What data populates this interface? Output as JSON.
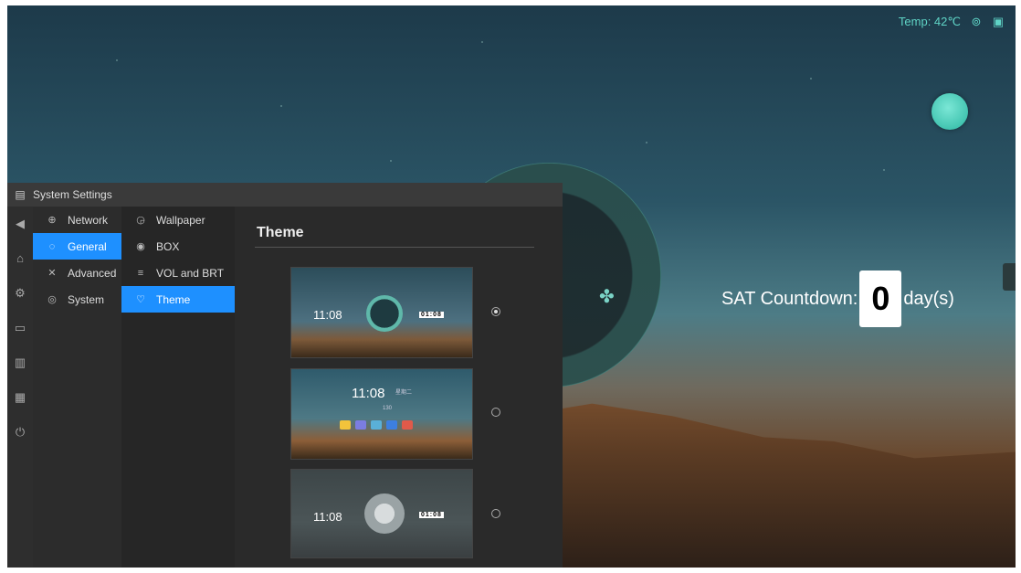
{
  "status_bar": {
    "temp": "Temp: 42℃"
  },
  "countdown": {
    "label": "SAT Countdown:",
    "digit": "0",
    "unit": "day(s)"
  },
  "settings": {
    "title": "System Settings",
    "categories": [
      {
        "label": "Network",
        "icon": "globe-icon"
      },
      {
        "label": "General",
        "icon": "palette-icon",
        "active": true
      },
      {
        "label": "Advanced",
        "icon": "tools-icon"
      },
      {
        "label": "System",
        "icon": "info-icon"
      }
    ],
    "subitems": [
      {
        "label": "Wallpaper",
        "icon": "picture-icon"
      },
      {
        "label": "BOX",
        "icon": "box-icon"
      },
      {
        "label": "VOL and BRT",
        "icon": "sliders-icon"
      },
      {
        "label": "Theme",
        "icon": "shirt-icon",
        "active": true
      }
    ],
    "content_title": "Theme",
    "themes": [
      {
        "time": "11:08",
        "selected": true,
        "flip": "01:08"
      },
      {
        "time": "11:08",
        "weekday": "星期二",
        "selected": false,
        "note": "130"
      },
      {
        "time": "11:08",
        "selected": false,
        "flip": "01:08"
      }
    ]
  },
  "colors": {
    "accent": "#1e90ff",
    "teal": "#5fd3c5"
  }
}
